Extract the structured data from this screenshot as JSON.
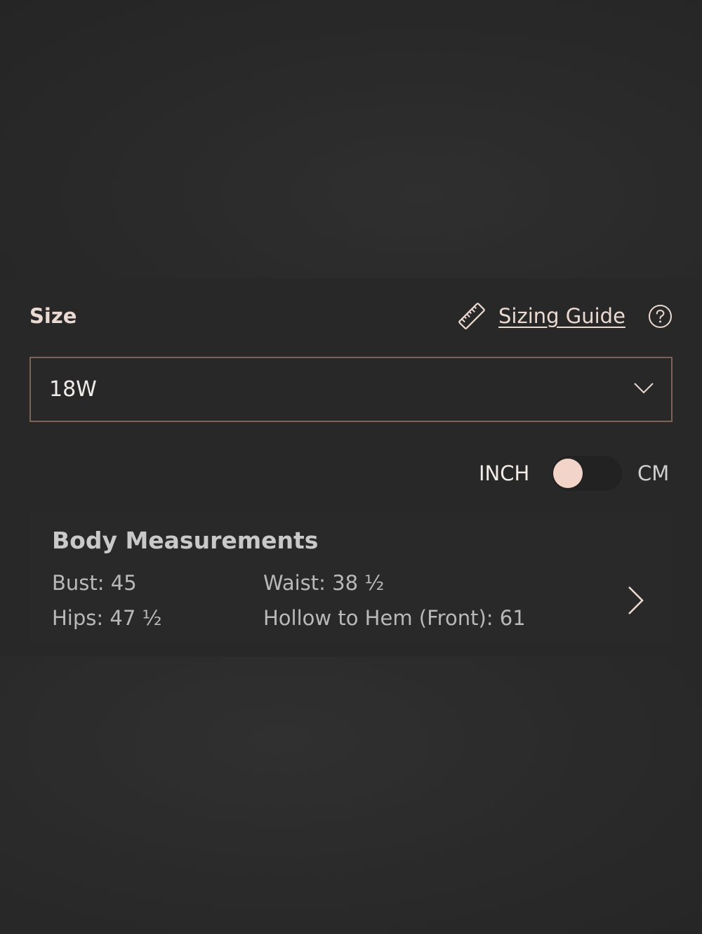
{
  "size_section": {
    "label": "Size",
    "sizing_guide_label": "Sizing Guide",
    "selected_size": "18W"
  },
  "units": {
    "inch_label": "INCH",
    "cm_label": "CM",
    "selected": "INCH"
  },
  "measurements": {
    "title": "Body Measurements",
    "bust": "Bust: 45",
    "waist": "Waist: 38 ½",
    "hips": "Hips: 47 ½",
    "hollow_to_hem": "Hollow to Hem (Front): 61"
  },
  "colors": {
    "accent": "#f3d4c8",
    "border": "#7d6357",
    "background": "#282828"
  },
  "icons": [
    "ruler-icon",
    "help-icon",
    "chevron-down-icon",
    "chevron-right-icon"
  ]
}
